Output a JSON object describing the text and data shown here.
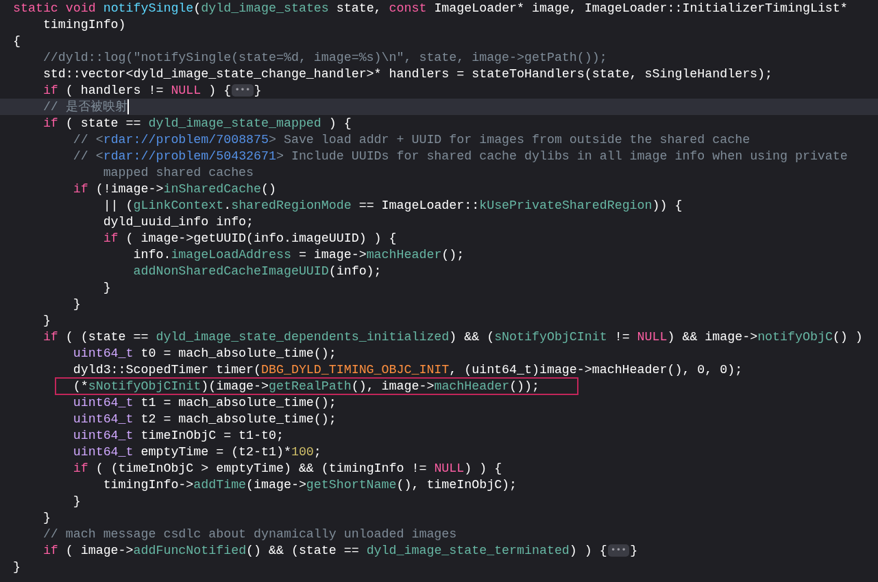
{
  "editor": {
    "lines": [
      {
        "highlighted": false,
        "boxed": false,
        "tokens": [
          {
            "kind": "kw",
            "text": "static"
          },
          {
            "kind": "kw",
            "text": " void"
          },
          {
            "kind": "decl",
            "text": " notifySingle"
          },
          {
            "kind": "plain",
            "text": "("
          },
          {
            "kind": "proj",
            "text": "dyld_image_states"
          },
          {
            "kind": "plain",
            "text": " state, "
          },
          {
            "kind": "kw",
            "text": "const"
          },
          {
            "kind": "plain",
            "text": " ImageLoader* image, ImageLoader::InitializerTimingList*"
          }
        ]
      },
      {
        "highlighted": false,
        "boxed": false,
        "tokens": [
          {
            "kind": "plain",
            "text": "    timingInfo)"
          }
        ]
      },
      {
        "highlighted": false,
        "boxed": false,
        "tokens": [
          {
            "kind": "plain",
            "text": "{"
          }
        ]
      },
      {
        "highlighted": false,
        "boxed": false,
        "tokens": [
          {
            "kind": "comment",
            "text": "    //dyld::log(\"notifySingle(state=%d, image=%s)\\n\", state, image->getPath());"
          }
        ]
      },
      {
        "highlighted": false,
        "boxed": false,
        "tokens": [
          {
            "kind": "plain",
            "text": "    std::vector<dyld_image_state_change_handler>* handlers = stateToHandlers(state, sSingleHandlers);"
          }
        ]
      },
      {
        "highlighted": false,
        "boxed": false,
        "tokens": [
          {
            "kind": "kw",
            "text": "    if"
          },
          {
            "kind": "plain",
            "text": " ( handlers != "
          },
          {
            "kind": "kw",
            "text": "NULL"
          },
          {
            "kind": "plain",
            "text": " ) {"
          },
          {
            "kind": "fold",
            "text": "•••"
          },
          {
            "kind": "plain",
            "text": "}"
          }
        ]
      },
      {
        "highlighted": true,
        "boxed": false,
        "tokens": [
          {
            "kind": "comment",
            "text": "    // 是否被映射"
          }
        ]
      },
      {
        "highlighted": false,
        "boxed": false,
        "tokens": [
          {
            "kind": "kw",
            "text": "    if"
          },
          {
            "kind": "plain",
            "text": " ( state == "
          },
          {
            "kind": "proj",
            "text": "dyld_image_state_mapped"
          },
          {
            "kind": "plain",
            "text": " ) {"
          }
        ]
      },
      {
        "highlighted": false,
        "boxed": false,
        "tokens": [
          {
            "kind": "comment",
            "text": "        // <"
          },
          {
            "kind": "link",
            "text": "rdar://problem/7008875"
          },
          {
            "kind": "comment",
            "text": "> Save load addr + UUID for images from outside the shared cache"
          }
        ]
      },
      {
        "highlighted": false,
        "boxed": false,
        "tokens": [
          {
            "kind": "comment",
            "text": "        // <"
          },
          {
            "kind": "link",
            "text": "rdar://problem/50432671"
          },
          {
            "kind": "comment",
            "text": "> Include UUIDs for shared cache dylibs in all image info when using private"
          }
        ]
      },
      {
        "highlighted": false,
        "boxed": false,
        "tokens": [
          {
            "kind": "comment",
            "text": "            mapped shared caches"
          }
        ]
      },
      {
        "highlighted": false,
        "boxed": false,
        "tokens": [
          {
            "kind": "kw",
            "text": "        if"
          },
          {
            "kind": "plain",
            "text": " (!image->"
          },
          {
            "kind": "proj",
            "text": "inSharedCache"
          },
          {
            "kind": "plain",
            "text": "()"
          }
        ]
      },
      {
        "highlighted": false,
        "boxed": false,
        "tokens": [
          {
            "kind": "plain",
            "text": "            || ("
          },
          {
            "kind": "proj",
            "text": "gLinkContext"
          },
          {
            "kind": "plain",
            "text": "."
          },
          {
            "kind": "proj",
            "text": "sharedRegionMode"
          },
          {
            "kind": "plain",
            "text": " == ImageLoader::"
          },
          {
            "kind": "proj",
            "text": "kUsePrivateSharedRegion"
          },
          {
            "kind": "plain",
            "text": ")) {"
          }
        ]
      },
      {
        "highlighted": false,
        "boxed": false,
        "tokens": [
          {
            "kind": "plain",
            "text": "            dyld_uuid_info info;"
          }
        ]
      },
      {
        "highlighted": false,
        "boxed": false,
        "tokens": [
          {
            "kind": "kw",
            "text": "            if"
          },
          {
            "kind": "plain",
            "text": " ( image->getUUID(info.imageUUID) ) {"
          }
        ]
      },
      {
        "highlighted": false,
        "boxed": false,
        "tokens": [
          {
            "kind": "plain",
            "text": "                info."
          },
          {
            "kind": "proj",
            "text": "imageLoadAddress"
          },
          {
            "kind": "plain",
            "text": " = image->"
          },
          {
            "kind": "proj",
            "text": "machHeader"
          },
          {
            "kind": "plain",
            "text": "();"
          }
        ]
      },
      {
        "highlighted": false,
        "boxed": false,
        "tokens": [
          {
            "kind": "proj",
            "text": "                addNonSharedCacheImageUUID"
          },
          {
            "kind": "plain",
            "text": "(info);"
          }
        ]
      },
      {
        "highlighted": false,
        "boxed": false,
        "tokens": [
          {
            "kind": "plain",
            "text": "            }"
          }
        ]
      },
      {
        "highlighted": false,
        "boxed": false,
        "tokens": [
          {
            "kind": "plain",
            "text": "        }"
          }
        ]
      },
      {
        "highlighted": false,
        "boxed": false,
        "tokens": [
          {
            "kind": "plain",
            "text": "    }"
          }
        ]
      },
      {
        "highlighted": false,
        "boxed": false,
        "tokens": [
          {
            "kind": "kw",
            "text": "    if"
          },
          {
            "kind": "plain",
            "text": " ( (state == "
          },
          {
            "kind": "proj",
            "text": "dyld_image_state_dependents_initialized"
          },
          {
            "kind": "plain",
            "text": ") && ("
          },
          {
            "kind": "proj",
            "text": "sNotifyObjCInit"
          },
          {
            "kind": "plain",
            "text": " != "
          },
          {
            "kind": "kw",
            "text": "NULL"
          },
          {
            "kind": "plain",
            "text": ") && image->"
          },
          {
            "kind": "proj",
            "text": "notifyObjC"
          },
          {
            "kind": "plain",
            "text": "() )"
          }
        ]
      },
      {
        "highlighted": false,
        "boxed": false,
        "tokens": [
          {
            "kind": "type",
            "text": "        uint64_t"
          },
          {
            "kind": "plain",
            "text": " t0 = mach_absolute_time();"
          }
        ]
      },
      {
        "highlighted": false,
        "boxed": false,
        "tokens": [
          {
            "kind": "plain",
            "text": "        dyld3::ScopedTimer timer("
          },
          {
            "kind": "macro",
            "text": "DBG_DYLD_TIMING_OBJC_INIT"
          },
          {
            "kind": "plain",
            "text": ", (uint64_t)image->machHeader(), 0, 0);"
          }
        ]
      },
      {
        "highlighted": false,
        "boxed": true,
        "tokens": [
          {
            "kind": "plain",
            "text": "        (*"
          },
          {
            "kind": "proj",
            "text": "sNotifyObjCInit"
          },
          {
            "kind": "plain",
            "text": ")(image->"
          },
          {
            "kind": "proj",
            "text": "getRealPath"
          },
          {
            "kind": "plain",
            "text": "(), image->"
          },
          {
            "kind": "proj",
            "text": "machHeader"
          },
          {
            "kind": "plain",
            "text": "());"
          }
        ]
      },
      {
        "highlighted": false,
        "boxed": false,
        "tokens": [
          {
            "kind": "type",
            "text": "        uint64_t"
          },
          {
            "kind": "plain",
            "text": " t1 = mach_absolute_time();"
          }
        ]
      },
      {
        "highlighted": false,
        "boxed": false,
        "tokens": [
          {
            "kind": "type",
            "text": "        uint64_t"
          },
          {
            "kind": "plain",
            "text": " t2 = mach_absolute_time();"
          }
        ]
      },
      {
        "highlighted": false,
        "boxed": false,
        "tokens": [
          {
            "kind": "type",
            "text": "        uint64_t"
          },
          {
            "kind": "plain",
            "text": " timeInObjC = t1-t0;"
          }
        ]
      },
      {
        "highlighted": false,
        "boxed": false,
        "tokens": [
          {
            "kind": "type",
            "text": "        uint64_t"
          },
          {
            "kind": "plain",
            "text": " emptyTime = (t2-t1)*"
          },
          {
            "kind": "num",
            "text": "100"
          },
          {
            "kind": "plain",
            "text": ";"
          }
        ]
      },
      {
        "highlighted": false,
        "boxed": false,
        "tokens": [
          {
            "kind": "kw",
            "text": "        if"
          },
          {
            "kind": "plain",
            "text": " ( (timeInObjC > emptyTime) && (timingInfo != "
          },
          {
            "kind": "kw",
            "text": "NULL"
          },
          {
            "kind": "plain",
            "text": ") ) {"
          }
        ]
      },
      {
        "highlighted": false,
        "boxed": false,
        "tokens": [
          {
            "kind": "plain",
            "text": "            timingInfo->"
          },
          {
            "kind": "proj",
            "text": "addTime"
          },
          {
            "kind": "plain",
            "text": "(image->"
          },
          {
            "kind": "proj",
            "text": "getShortName"
          },
          {
            "kind": "plain",
            "text": "(), timeInObjC);"
          }
        ]
      },
      {
        "highlighted": false,
        "boxed": false,
        "tokens": [
          {
            "kind": "plain",
            "text": "        }"
          }
        ]
      },
      {
        "highlighted": false,
        "boxed": false,
        "tokens": [
          {
            "kind": "plain",
            "text": "    }"
          }
        ]
      },
      {
        "highlighted": false,
        "boxed": false,
        "tokens": [
          {
            "kind": "comment",
            "text": "    // mach message csdlc about dynamically unloaded images"
          }
        ]
      },
      {
        "highlighted": false,
        "boxed": false,
        "tokens": [
          {
            "kind": "kw",
            "text": "    if"
          },
          {
            "kind": "plain",
            "text": " ( image->"
          },
          {
            "kind": "proj",
            "text": "addFuncNotified"
          },
          {
            "kind": "plain",
            "text": "() && (state == "
          },
          {
            "kind": "proj",
            "text": "dyld_image_state_terminated"
          },
          {
            "kind": "plain",
            "text": ") ) {"
          },
          {
            "kind": "fold",
            "text": "•••"
          },
          {
            "kind": "plain",
            "text": "}"
          }
        ]
      },
      {
        "highlighted": false,
        "boxed": false,
        "tokens": [
          {
            "kind": "plain",
            "text": "}"
          }
        ]
      }
    ]
  }
}
